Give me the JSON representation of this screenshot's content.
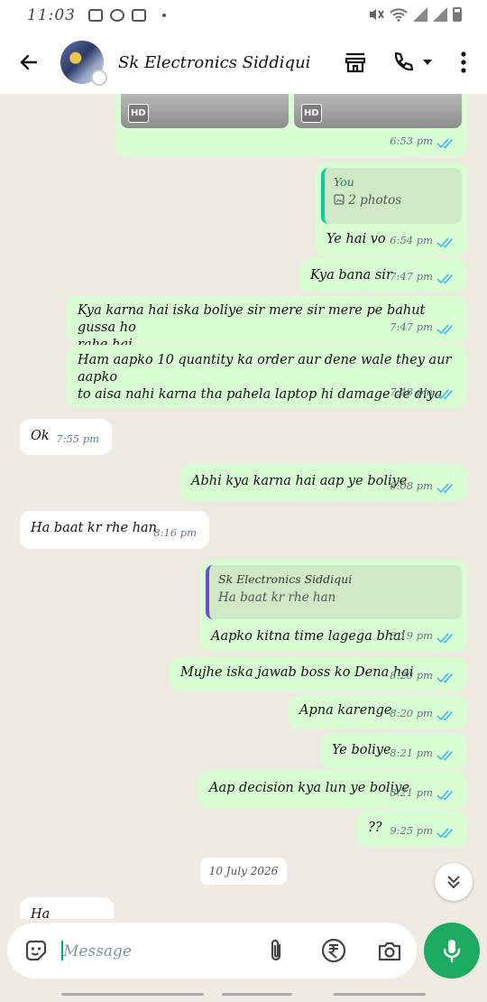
{
  "status_bar": {
    "time": "11:03"
  },
  "header": {
    "contact_name": "Sk Electronics Siddiqui"
  },
  "images": {
    "hd_label": "HD",
    "time": "6:53 pm"
  },
  "messages": [
    {
      "dir": "out",
      "quote_author": "You",
      "quote_text": "2 photos",
      "text": "Ye hai vo",
      "time": "6:54 pm"
    },
    {
      "dir": "out",
      "text": "Kya bana sir",
      "time": "7:47 pm"
    },
    {
      "dir": "out",
      "text_line1": "Kya karna hai iska boliye sir mere sir mere pe bahut gussa ho",
      "text_line2": "rahe hai",
      "time": "7:47 pm"
    },
    {
      "dir": "out",
      "text_line1": "Ham aapko 10 quantity ka order aur dene wale they aur aapko",
      "text_line2": "to aisa nahi karna tha pahela laptop hi damage de diya",
      "time": "7:48 pm"
    },
    {
      "dir": "in",
      "text": "Ok",
      "time": "7:55 pm"
    },
    {
      "dir": "out",
      "text": "Abhi kya karna hai aap ye boliye",
      "time": "8:08 pm"
    },
    {
      "dir": "in",
      "text": "Ha baat kr rhe han",
      "time": "8:16 pm"
    },
    {
      "dir": "out",
      "quote_author": "Sk Electronics Siddiqui",
      "quote_text": "Ha baat kr rhe han",
      "text": "Aapko kitna time lagega bhai",
      "time": "8:19 pm"
    },
    {
      "dir": "out",
      "text": "Mujhe iska jawab boss ko Dena hai",
      "time": "8:20 pm"
    },
    {
      "dir": "out",
      "text": "Apna karenge",
      "time": "8:20 pm"
    },
    {
      "dir": "out",
      "text": "Ye boliye",
      "time": "8:21 pm"
    },
    {
      "dir": "out",
      "text": "Aap decision kya lun ye boliye",
      "time": "8:21 pm"
    },
    {
      "dir": "out",
      "text": "??",
      "time": "9:25 pm"
    },
    {
      "dir": "in",
      "text": "Ha",
      "time": ""
    }
  ],
  "date_divider": "10 July 2026",
  "composer": {
    "placeholder": "Message"
  },
  "colors": {
    "outgoing_bubble": "#d9fdd3",
    "incoming_bubble": "#ffffff",
    "accent": "#1daa61",
    "read_tick": "#53bdeb"
  }
}
